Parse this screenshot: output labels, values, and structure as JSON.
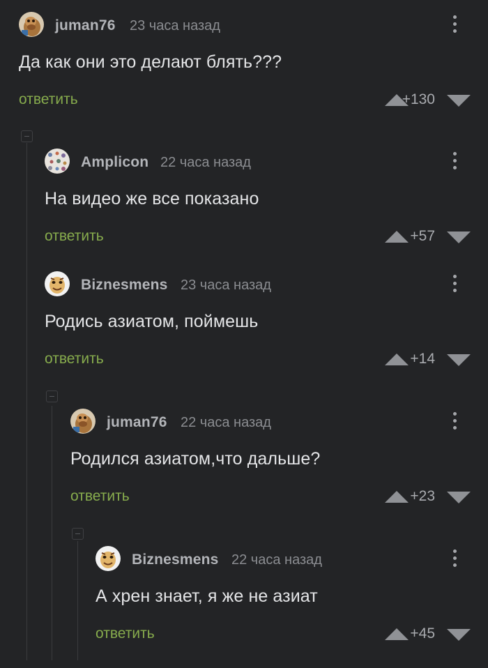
{
  "comments": [
    {
      "username": "juman76",
      "time": "23 часа назад",
      "text": "Да как они это делают блять???",
      "reply_label": "ответить",
      "score": "+130",
      "avatar_icon": "camel-avatar-icon"
    },
    {
      "username": "Amplicon",
      "time": "22 часа назад",
      "text": "На видео же все показано",
      "reply_label": "ответить",
      "score": "+57",
      "avatar_icon": "pattern-avatar-icon"
    },
    {
      "username": "Biznesmens",
      "time": "23 часа назад",
      "text": "Родись азиатом, поймешь",
      "reply_label": "ответить",
      "score": "+14",
      "avatar_icon": "cartoon-face-avatar-icon"
    },
    {
      "username": "juman76",
      "time": "22 часа назад",
      "text": "Родился азиатом,что дальше?",
      "reply_label": "ответить",
      "score": "+23",
      "avatar_icon": "camel-avatar-icon"
    },
    {
      "username": "Biznesmens",
      "time": "22 часа назад",
      "text": "А хрен знает, я же не азиат",
      "reply_label": "ответить",
      "score": "+45",
      "avatar_icon": "cartoon-face-avatar-icon"
    }
  ],
  "colors": {
    "background": "#232426",
    "reply_link": "#87ac4d",
    "username": "#b3b5b9",
    "timestamp": "#8b8d91",
    "text": "#e4e5e7"
  }
}
